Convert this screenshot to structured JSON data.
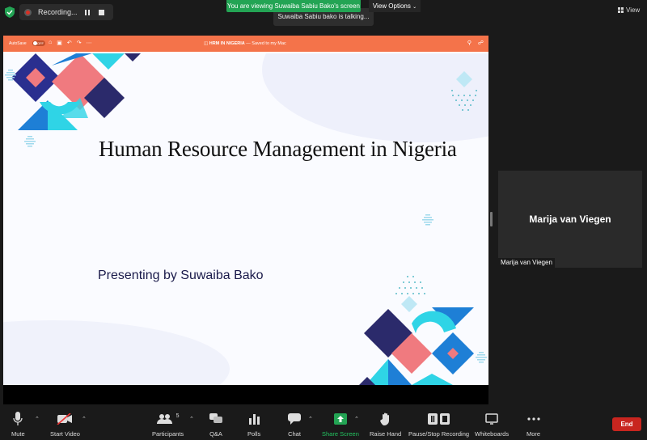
{
  "topbar": {
    "recording_label": "Recording...",
    "banner": "You are viewing Suwaiba Sabiu Bako's screen",
    "talking": "Suwaiba Sabiu bako is talking...",
    "view_options": "View Options",
    "view_label": "View"
  },
  "ppt": {
    "autosave_label": "AutoSave",
    "autosave_state": "OFF",
    "doc_title": "HRM IN NIGERIA",
    "doc_status": "— Saved to my Mac"
  },
  "slide": {
    "title": "Human Resource Management in Nigeria",
    "subtitle": "Presenting by Suwaiba Bako"
  },
  "participant": {
    "name": "Marija van Viegen"
  },
  "toolbar": {
    "mute": "Mute",
    "start_video": "Start Video",
    "participants": "Participants",
    "participants_count": "5",
    "qa": "Q&A",
    "polls": "Polls",
    "chat": "Chat",
    "share_screen": "Share Screen",
    "raise_hand": "Raise Hand",
    "pause_recording": "Pause/Stop Recording",
    "whiteboards": "Whiteboards",
    "more": "More",
    "end": "End"
  },
  "colors": {
    "share_green": "#23a454",
    "ppt_orange": "#f4734a",
    "end_red": "#c8251f",
    "slide_navy": "#2b2a6b",
    "slide_coral": "#f07a7f",
    "slide_cyan": "#2fd4e6",
    "slide_blue": "#1e7fd6"
  }
}
